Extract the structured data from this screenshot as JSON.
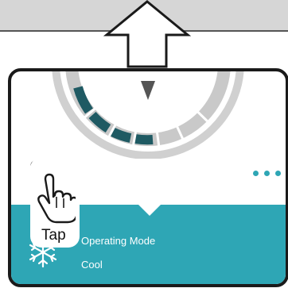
{
  "overlay": {
    "tap_label": "Tap"
  },
  "mode_panel": {
    "title": "Operating Mode",
    "value": "Cool"
  },
  "icons": {
    "up_arrow": "arrow-up-icon",
    "fan": "fan-speed-icon",
    "more": "more-options-icon",
    "mode": "snowflake-icon",
    "hand": "hand-pointer-icon"
  },
  "colors": {
    "accent": "#2ea6b5",
    "dial_active": "#1f5a63",
    "dial_inactive": "#c9c9c9",
    "card_border": "#1a1a1a"
  }
}
